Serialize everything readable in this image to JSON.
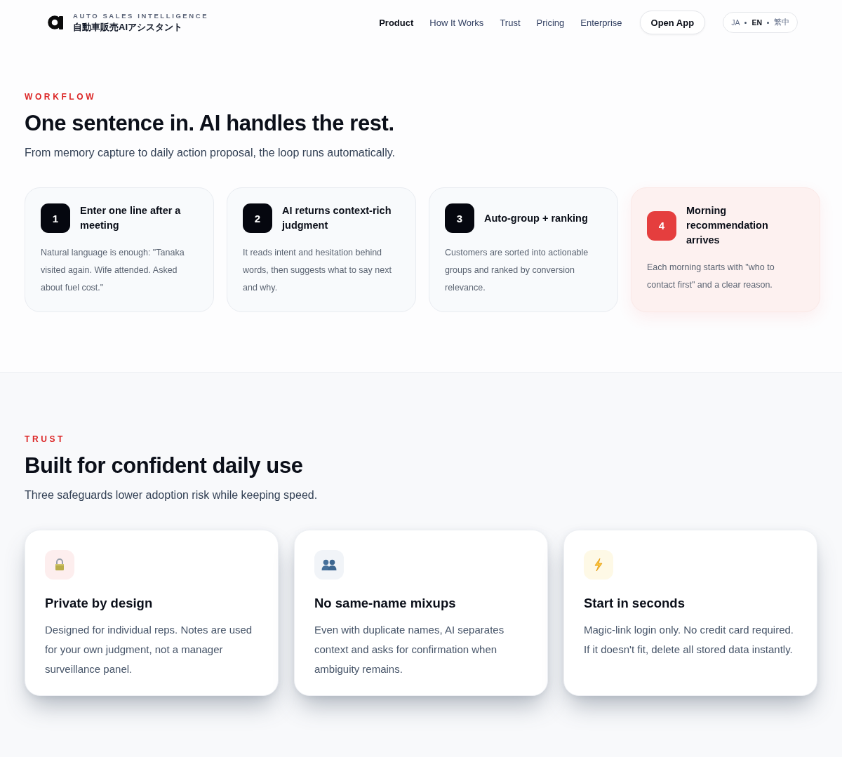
{
  "header": {
    "brand": {
      "tagline": "AUTO SALES INTELLIGENCE",
      "name": "自動車販売AIアシスタント"
    },
    "nav": [
      {
        "label": "Product",
        "selected": true
      },
      {
        "label": "How It Works",
        "selected": false
      },
      {
        "label": "Trust",
        "selected": false
      },
      {
        "label": "Pricing",
        "selected": false
      },
      {
        "label": "Enterprise",
        "selected": false
      }
    ],
    "open_app_button": "Open App",
    "languages": [
      {
        "label": "JA",
        "selected": false
      },
      {
        "label": "EN",
        "selected": true
      },
      {
        "label": "繁中",
        "selected": false
      }
    ]
  },
  "workflow": {
    "eyebrow": "WORKFLOW",
    "heading": "One sentence in. AI handles the rest.",
    "subtitle": "From memory capture to daily action proposal, the loop runs automatically.",
    "steps": [
      {
        "number": "1",
        "title": "Enter one line after a meeting",
        "description": "Natural language is enough: \"Tanaka visited again. Wife attended. Asked about fuel cost.\"",
        "highlighted": false
      },
      {
        "number": "2",
        "title": "AI returns context-rich judgment",
        "description": "It reads intent and hesitation behind words, then suggests what to say next and why.",
        "highlighted": false
      },
      {
        "number": "3",
        "title": "Auto-group + ranking",
        "description": "Customers are sorted into actionable groups and ranked by conversion relevance.",
        "highlighted": false
      },
      {
        "number": "4",
        "title": "Morning recommendation arrives",
        "description": "Each morning starts with \"who to contact first\" and a clear reason.",
        "highlighted": true
      }
    ]
  },
  "trust": {
    "eyebrow": "TRUST",
    "heading": "Built for confident daily use",
    "subtitle": "Three safeguards lower adoption risk while keeping speed.",
    "cards": [
      {
        "kind": "lock",
        "title": "Private by design",
        "description": "Designed for individual reps. Notes are used for your own judgment, not a manager surveillance panel."
      },
      {
        "kind": "people",
        "title": "No same-name mixups",
        "description": "Even with duplicate names, AI separates context and asks for confirmation when ambiguity remains."
      },
      {
        "kind": "bolt",
        "title": "Start in seconds",
        "description": "Magic-link login only. No credit card required. If it doesn't fit, delete all stored data instantly."
      }
    ]
  }
}
